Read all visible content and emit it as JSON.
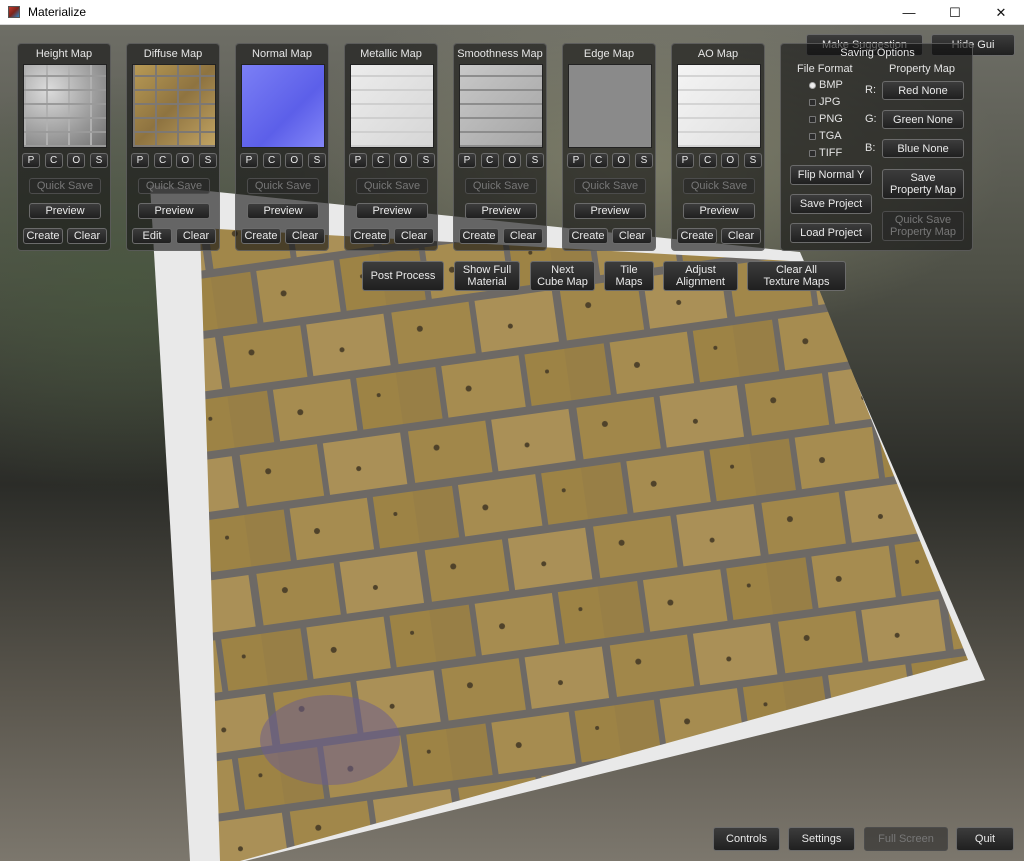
{
  "window": {
    "title": "Materialize",
    "minimize_glyph": "—",
    "maximize_glyph": "☐",
    "close_glyph": "✕"
  },
  "map_panels": [
    {
      "title": "Height Map",
      "thumb": "height",
      "buttons": [
        "P",
        "C",
        "O",
        "S"
      ],
      "quick_save": "Quick Save",
      "preview": "Preview",
      "left_button": "Create",
      "clear": "Clear"
    },
    {
      "title": "Diffuse Map",
      "thumb": "diffuse",
      "buttons": [
        "P",
        "C",
        "O",
        "S"
      ],
      "quick_save": "Quick Save",
      "preview": "Preview",
      "left_button": "Edit",
      "clear": "Clear"
    },
    {
      "title": "Normal Map",
      "thumb": "normal",
      "buttons": [
        "P",
        "C",
        "O",
        "S"
      ],
      "quick_save": "Quick Save",
      "preview": "Preview",
      "left_button": "Create",
      "clear": "Clear"
    },
    {
      "title": "Metallic Map",
      "thumb": "metallic",
      "buttons": [
        "P",
        "C",
        "O",
        "S"
      ],
      "quick_save": "Quick Save",
      "preview": "Preview",
      "left_button": "Create",
      "clear": "Clear"
    },
    {
      "title": "Smoothness Map",
      "thumb": "smoothness",
      "buttons": [
        "P",
        "C",
        "O",
        "S"
      ],
      "quick_save": "Quick Save",
      "preview": "Preview",
      "left_button": "Create",
      "clear": "Clear"
    },
    {
      "title": "Edge Map",
      "thumb": "edge",
      "buttons": [
        "P",
        "C",
        "O",
        "S"
      ],
      "quick_save": "Quick Save",
      "preview": "Preview",
      "left_button": "Create",
      "clear": "Clear"
    },
    {
      "title": "AO Map",
      "thumb": "ao",
      "buttons": [
        "P",
        "C",
        "O",
        "S"
      ],
      "quick_save": "Quick Save",
      "preview": "Preview",
      "left_button": "Create",
      "clear": "Clear"
    }
  ],
  "top_right": {
    "make_suggestion": "Make Suggestion",
    "hide_gui": "Hide Gui"
  },
  "saving_options": {
    "title": "Saving Options",
    "file_format_label": "File Format",
    "formats": [
      "BMP",
      "JPG",
      "PNG",
      "TGA",
      "TIFF"
    ],
    "selected_format": "BMP",
    "property_map_label": "Property Map",
    "r_label": "R:",
    "g_label": "G:",
    "b_label": "B:",
    "red_button": "Red None",
    "green_button": "Green None",
    "blue_button": "Blue None",
    "flip_normal_y": "Flip Normal Y",
    "save_project": "Save Project",
    "load_project": "Load Project",
    "save_property_map": "Save\nProperty Map",
    "quick_save_property_map": "Quick Save\nProperty Map"
  },
  "toolbar": {
    "post_process": "Post Process",
    "show_full_material": "Show Full\nMaterial",
    "next_cube_map": "Next\nCube Map",
    "tile_maps": "Tile\nMaps",
    "adjust_alignment": "Adjust\nAlignment",
    "clear_all": "Clear All\nTexture Maps"
  },
  "bottom": {
    "controls": "Controls",
    "settings": "Settings",
    "full_screen": "Full Screen",
    "quit": "Quit"
  },
  "colors": {
    "brick": "#b89a55",
    "mortar": "#7d7873",
    "normal_map": "#6f73f2",
    "edge_map": "#8a8a8a"
  }
}
